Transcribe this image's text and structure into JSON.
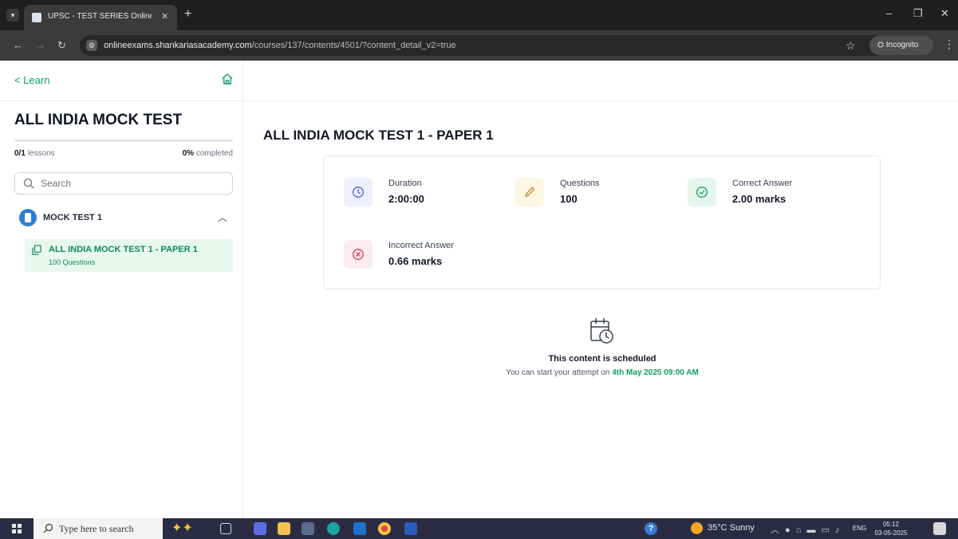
{
  "browser": {
    "tab_title": "UPSC - TEST SERIES Online Exa",
    "url_host": "onlineexams.shankariasacademy.com",
    "url_path": "/courses/137/contents/4501/?content_detail_v2=true",
    "incognito_label": "Incognito"
  },
  "sidebar": {
    "back_label": "< Learn",
    "course_title": "ALL INDIA MOCK TEST",
    "lessons_count": "0/1",
    "lessons_label": "lessons",
    "completed_pct": "0%",
    "completed_label": "completed",
    "progress_fraction": 0,
    "search_placeholder": "Search",
    "section_title": "MOCK TEST 1",
    "lesson": {
      "title": "ALL INDIA MOCK TEST 1 - PAPER 1",
      "subtitle": "100 Questions"
    }
  },
  "main": {
    "title": "ALL INDIA MOCK TEST 1 - PAPER 1",
    "stats": [
      {
        "label": "Duration",
        "value": "2:00:00",
        "icon": "clock-icon"
      },
      {
        "label": "Questions",
        "value": "100",
        "icon": "pencil-icon"
      },
      {
        "label": "Correct Answer",
        "value": "2.00 marks",
        "icon": "check-circle-icon"
      },
      {
        "label": "Incorrect Answer",
        "value": "0.66 marks",
        "icon": "x-circle-icon"
      }
    ],
    "schedule": {
      "title": "This content is scheduled",
      "text_prefix": "You can start your attempt on",
      "datetime": "4th May 2025 09:00 AM"
    }
  },
  "taskbar": {
    "search_text": "Type here to search",
    "weather": "35°C  Sunny",
    "lang": "ENG",
    "time": "05:12",
    "date": "03-05-2025"
  },
  "colors": {
    "accent": "#0f9d63",
    "duration_bg": "#eef0fb",
    "questions_bg": "#fdf6e3",
    "correct_bg": "#e6f6ee",
    "incorrect_bg": "#fdecef"
  }
}
